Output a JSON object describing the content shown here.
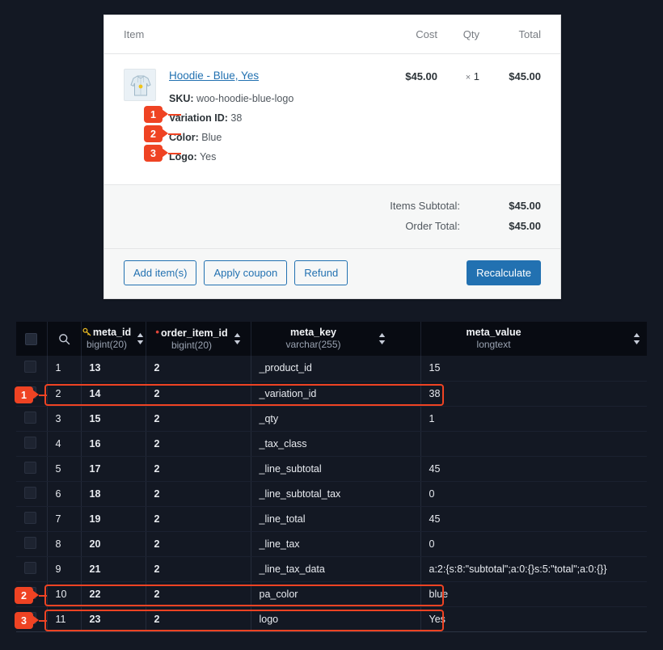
{
  "order_panel": {
    "columns": {
      "item": "Item",
      "cost": "Cost",
      "qty": "Qty",
      "total": "Total"
    },
    "line_item": {
      "title": "Hoodie - Blue, Yes",
      "sku_label": "SKU:",
      "sku_value": "woo-hoodie-blue-logo",
      "cost": "$45.00",
      "qty_sep": "×",
      "qty": "1",
      "total": "$45.00",
      "thumbnail_alt": "hoodie-product-thumbnail",
      "meta": [
        {
          "label": "Variation ID:",
          "value": "38"
        },
        {
          "label": "Color:",
          "value": "Blue"
        },
        {
          "label": "Logo:",
          "value": "Yes"
        }
      ]
    },
    "totals": [
      {
        "label": "Items Subtotal:",
        "value": "$45.00"
      },
      {
        "label": "Order Total:",
        "value": "$45.00"
      }
    ],
    "actions": {
      "add_items": "Add item(s)",
      "apply_coupon": "Apply coupon",
      "refund": "Refund",
      "recalculate": "Recalculate"
    }
  },
  "db_table": {
    "search_icon": "search-icon",
    "columns": [
      {
        "name": "meta_id",
        "type": "bigint(20)",
        "icon": "primary-key-icon",
        "sortable": true
      },
      {
        "name": "order_item_id",
        "type": "bigint(20)",
        "icon": "required-asterisk-icon",
        "sortable": true
      },
      {
        "name": "meta_key",
        "type": "varchar(255)",
        "icon": "",
        "sortable": true
      },
      {
        "name": "meta_value",
        "type": "longtext",
        "icon": "",
        "sortable": true
      }
    ],
    "rows": [
      {
        "n": "1",
        "meta_id": "13",
        "order_item_id": "2",
        "meta_key": "_product_id",
        "meta_value": "15"
      },
      {
        "n": "2",
        "meta_id": "14",
        "order_item_id": "2",
        "meta_key": "_variation_id",
        "meta_value": "38"
      },
      {
        "n": "3",
        "meta_id": "15",
        "order_item_id": "2",
        "meta_key": "_qty",
        "meta_value": "1"
      },
      {
        "n": "4",
        "meta_id": "16",
        "order_item_id": "2",
        "meta_key": "_tax_class",
        "meta_value": ""
      },
      {
        "n": "5",
        "meta_id": "17",
        "order_item_id": "2",
        "meta_key": "_line_subtotal",
        "meta_value": "45"
      },
      {
        "n": "6",
        "meta_id": "18",
        "order_item_id": "2",
        "meta_key": "_line_subtotal_tax",
        "meta_value": "0"
      },
      {
        "n": "7",
        "meta_id": "19",
        "order_item_id": "2",
        "meta_key": "_line_total",
        "meta_value": "45"
      },
      {
        "n": "8",
        "meta_id": "20",
        "order_item_id": "2",
        "meta_key": "_line_tax",
        "meta_value": "0"
      },
      {
        "n": "9",
        "meta_id": "21",
        "order_item_id": "2",
        "meta_key": "_line_tax_data",
        "meta_value": "a:2:{s:8:\"subtotal\";a:0:{}s:5:\"total\";a:0:{}}"
      },
      {
        "n": "10",
        "meta_id": "22",
        "order_item_id": "2",
        "meta_key": "pa_color",
        "meta_value": "blue"
      },
      {
        "n": "11",
        "meta_id": "23",
        "order_item_id": "2",
        "meta_key": "logo",
        "meta_value": "Yes"
      }
    ]
  },
  "callouts": {
    "accent_color": "#ef4323",
    "panel": [
      {
        "num": "1"
      },
      {
        "num": "2"
      },
      {
        "num": "3"
      }
    ],
    "table": [
      {
        "num": "1"
      },
      {
        "num": "2"
      },
      {
        "num": "3"
      }
    ]
  }
}
